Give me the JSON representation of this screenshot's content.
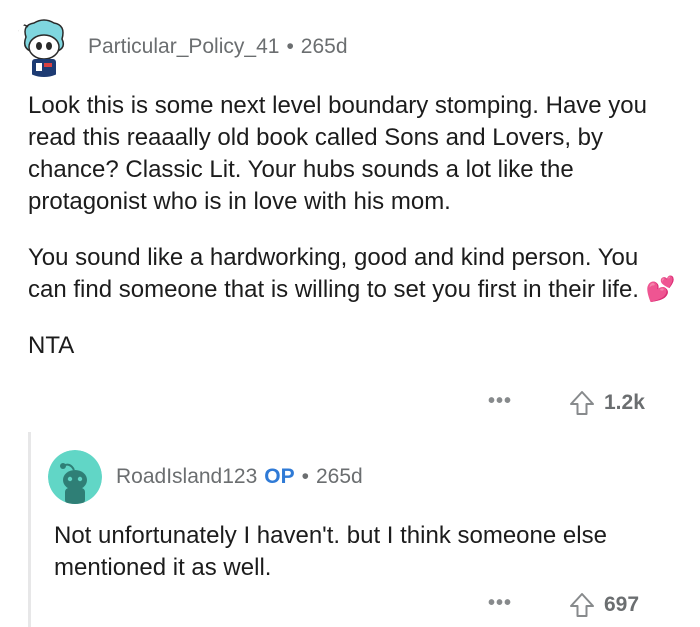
{
  "parent_comment": {
    "username": "Particular_Policy_41",
    "separator": "•",
    "age": "265d",
    "paragraph1": "Look this is some next level boundary stomping. Have you read this reaaally old book called Sons and Lovers, by chance? Classic Lit. Your hubs sounds a lot like the protagonist who is in love with his mom.",
    "paragraph2": "You sound like a hardworking, good and kind person. You can find someone that is willing to set you first in their life.",
    "emoji": "💕",
    "paragraph3": "NTA",
    "more_label": "•••",
    "upvote_icon": "upvote-arrow-icon",
    "vote_count": "1.2k"
  },
  "reply_comment": {
    "username": "RoadIsland123",
    "op_badge": "OP",
    "separator": "•",
    "age": "265d",
    "text": "Not unfortunately I haven't. but I think someone else mentioned it as well.",
    "more_label": "•••",
    "upvote_icon": "upvote-arrow-icon",
    "vote_count": "697"
  },
  "colors": {
    "meta_gray": "#6b6e70",
    "op_blue": "#2f7ad6",
    "thread_line": "#e7e7e8",
    "avatar_teal": "#61d6c6"
  }
}
